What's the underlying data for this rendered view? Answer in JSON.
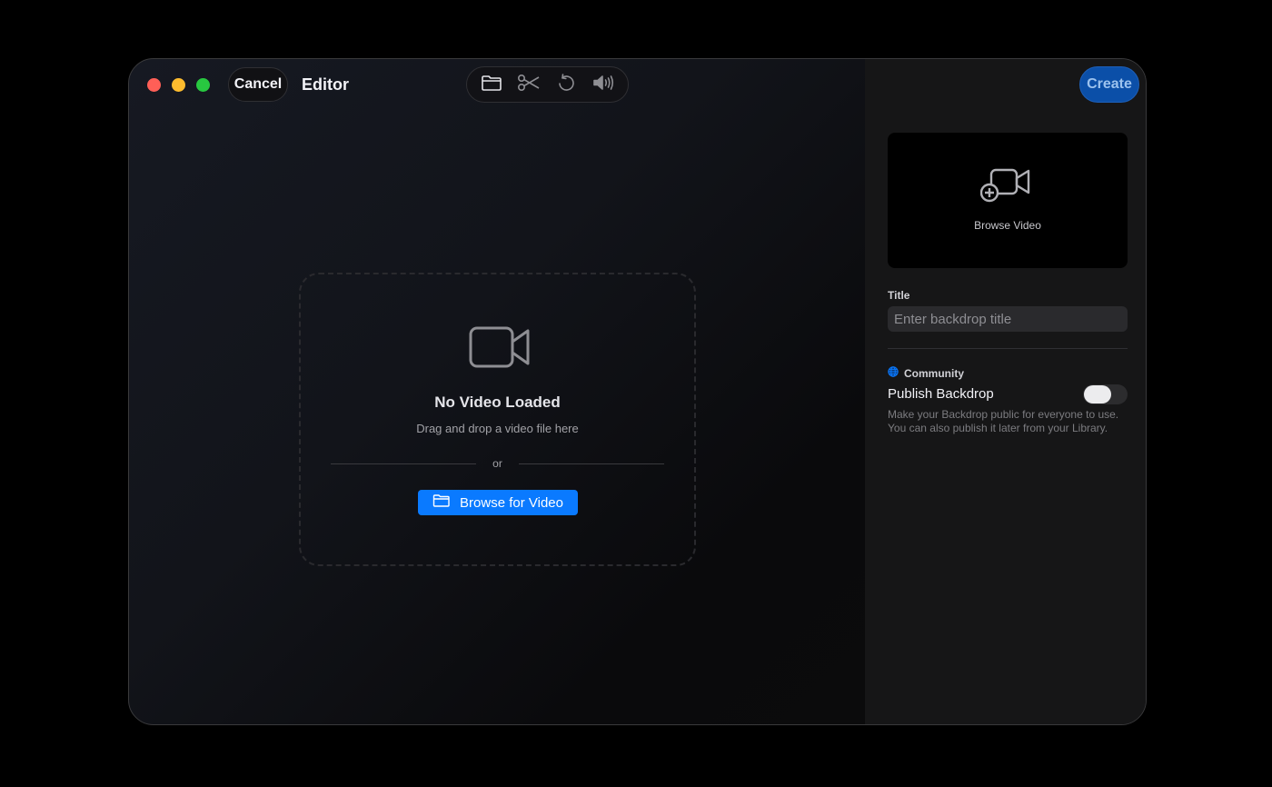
{
  "window": {
    "cancel_label": "Cancel",
    "title": "Editor",
    "create_label": "Create"
  },
  "toolbar": {
    "items": [
      {
        "name": "folder-icon"
      },
      {
        "name": "scissors-icon"
      },
      {
        "name": "undo-icon"
      },
      {
        "name": "volume-icon"
      }
    ]
  },
  "dropzone": {
    "icon": "video-camera-icon",
    "title": "No Video Loaded",
    "subtitle": "Drag and drop a video file here",
    "or_label": "or",
    "browse_label": "Browse for Video"
  },
  "sidebar": {
    "preview": {
      "icon": "video-add-icon",
      "label": "Browse Video"
    },
    "title_field": {
      "label": "Title",
      "value": "",
      "placeholder": "Enter backdrop title"
    },
    "community": {
      "label": "Community",
      "icon": "globe-icon"
    },
    "publish": {
      "label": "Publish Backdrop",
      "enabled": false,
      "description": "Make your Backdrop public for everyone to use. You can also publish it later from your Library."
    }
  },
  "colors": {
    "accent": "#0a7aff",
    "create_button": "#0b4fa8",
    "close": "#ff5f57",
    "minimize": "#febc2e",
    "maximize": "#28c840"
  }
}
